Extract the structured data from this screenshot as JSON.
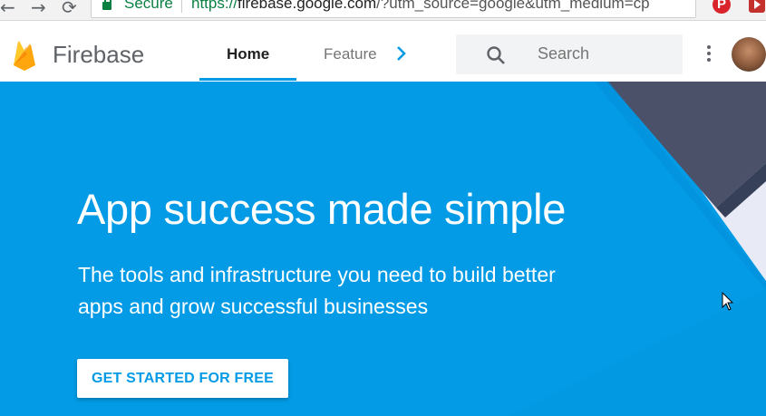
{
  "browser": {
    "back_glyph": "←",
    "forward_glyph": "→",
    "reload_glyph": "⟳",
    "secure_label": "Secure",
    "url_scheme": "https://",
    "url_host": "firebase.google.com",
    "url_rest": "/?utm_source=google&utm_medium=cp",
    "star_glyph": "☆",
    "pinterest_glyph": "P"
  },
  "header": {
    "brand": "Firebase",
    "tabs": [
      {
        "label": "Home",
        "active": true
      },
      {
        "label": "Features",
        "active": false
      }
    ],
    "search_placeholder": "Search"
  },
  "hero": {
    "headline": "App success made simple",
    "subhead": "The tools and infrastructure you need to build better apps and grow successful businesses",
    "cta_label": "GET STARTED FOR FREE"
  },
  "colors": {
    "hero_bg": "#039be5",
    "accent": "#039be5",
    "deco_dark": "#4a5169",
    "deco_light": "#e8eaf6"
  }
}
